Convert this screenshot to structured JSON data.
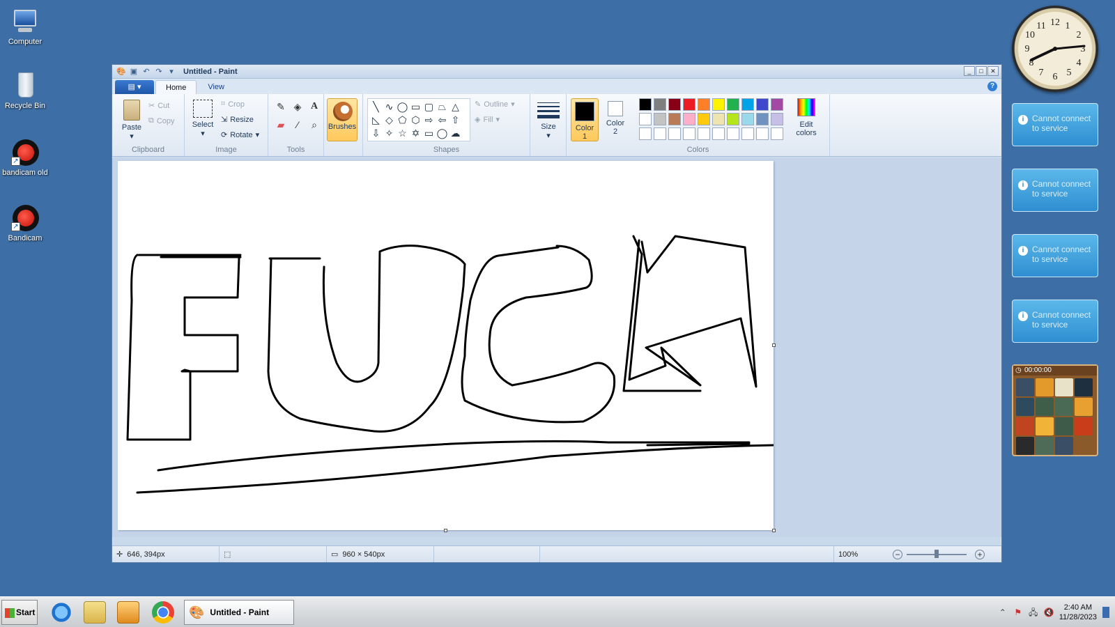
{
  "desktop": {
    "icons": [
      {
        "label": "Computer"
      },
      {
        "label": "Recycle Bin"
      },
      {
        "label": "bandicam old"
      },
      {
        "label": "Bandicam"
      }
    ]
  },
  "window": {
    "title": "Untitled - Paint",
    "tabs": [
      "Home",
      "View"
    ],
    "app_menu_label": "▤ ▾"
  },
  "ribbon": {
    "clipboard": {
      "label": "Clipboard",
      "paste": "Paste",
      "cut": "Cut",
      "copy": "Copy"
    },
    "image": {
      "label": "Image",
      "select": "Select",
      "crop": "Crop",
      "resize": "Resize",
      "rotate": "Rotate"
    },
    "tools": {
      "label": "Tools"
    },
    "brushes": {
      "label": "Brushes"
    },
    "shapes": {
      "label": "Shapes",
      "outline": "Outline",
      "fill": "Fill"
    },
    "size": {
      "label": "Size"
    },
    "colors": {
      "label": "Colors",
      "color1_label": "Color\n1",
      "color2_label": "Color\n2",
      "color1": "#000000",
      "color2": "#ffffff",
      "edit_colors": "Edit colors",
      "palette": [
        "#000000",
        "#7f7f7f",
        "#880015",
        "#ed1c24",
        "#ff7f27",
        "#fff200",
        "#22b14c",
        "#00a2e8",
        "#3f48cc",
        "#a349a4",
        "#ffffff",
        "#c3c3c3",
        "#b97a57",
        "#ffaec9",
        "#ffc90e",
        "#efe4b0",
        "#b5e61d",
        "#99d9ea",
        "#7092be",
        "#c8bfe7",
        "#ffffff",
        "#ffffff",
        "#ffffff",
        "#ffffff",
        "#ffffff",
        "#ffffff",
        "#ffffff",
        "#ffffff",
        "#ffffff",
        "#ffffff"
      ]
    }
  },
  "canvas": {
    "drawing_text": "FUCK"
  },
  "statusbar": {
    "cursor_pos": "646, 394px",
    "selection_size": "",
    "image_size": "960 × 540px",
    "zoom": "100%"
  },
  "gadgets": {
    "service_message_line1": "Cannot connect",
    "service_message_line2": "to service",
    "puzzle_timer": "00:00:00"
  },
  "taskbar": {
    "start_label": "Start",
    "active_task": "Untitled - Paint",
    "time": "2:40 AM",
    "date": "11/28/2023"
  }
}
